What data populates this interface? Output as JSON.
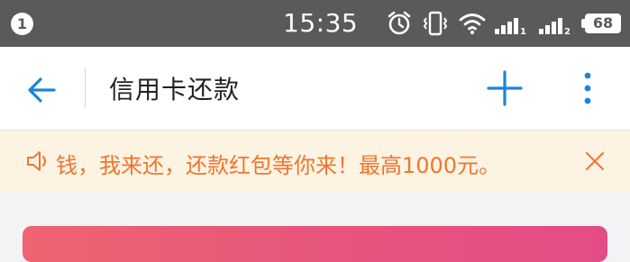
{
  "status_bar": {
    "notification_count": "1",
    "time": "15:35",
    "battery": "68"
  },
  "app_bar": {
    "title": "信用卡还款"
  },
  "banner": {
    "text": "钱，我来还，还款红包等你来！最高1000元。"
  },
  "colors": {
    "status_bar_bg": "#5a5a5a",
    "accent_blue": "#1a86d8",
    "banner_bg": "#fcf3e3",
    "banner_text": "#f0762d",
    "card_gradient_start": "#ee6472",
    "card_gradient_end": "#e34d86"
  }
}
